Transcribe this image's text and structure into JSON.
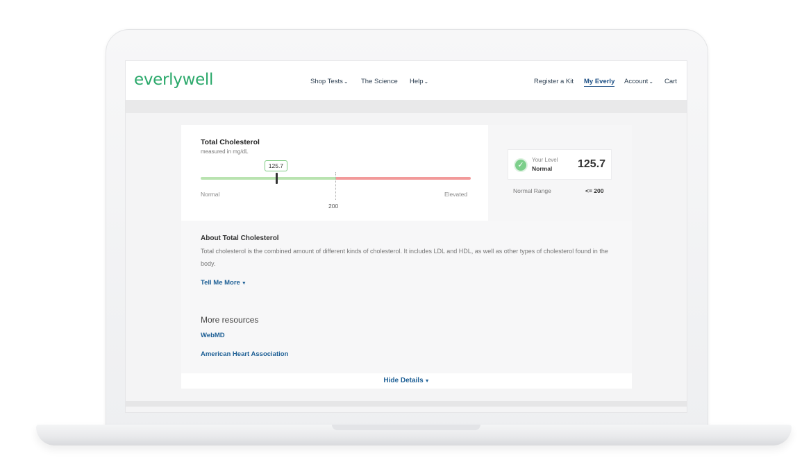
{
  "brand": {
    "logo": "everlywell",
    "color": "#2aa86a"
  },
  "nav": {
    "left": [
      {
        "label": "Shop Tests",
        "dropdown": true
      },
      {
        "label": "The Science",
        "dropdown": false
      },
      {
        "label": "Help",
        "dropdown": true
      }
    ],
    "right": [
      {
        "label": "Register a Kit",
        "dropdown": false
      },
      {
        "label": "My Everly",
        "dropdown": false,
        "active": true
      },
      {
        "label": "Account",
        "dropdown": true
      },
      {
        "label": "Cart",
        "dropdown": false
      }
    ]
  },
  "result": {
    "title": "Total Cholesterol",
    "unit_label": "measured in mg/dL",
    "value": "125.7",
    "range_low_label": "Normal",
    "range_high_label": "Elevated",
    "threshold": "200",
    "marker_fraction": 0.28,
    "level_label": "Your Level",
    "level_status": "Normal",
    "normal_range_label": "Normal Range",
    "normal_range_value": "<= 200",
    "colors": {
      "normal": "#b9e3b0",
      "elevated": "#f29a9a",
      "check": "#7ccf8b"
    }
  },
  "about": {
    "title": "About Total Cholesterol",
    "text": "Total cholesterol is the combined amount of different kinds of cholesterol. It includes LDL and HDL, as well as other types of cholesterol found in the body.",
    "tell_more": "Tell Me More"
  },
  "resources": {
    "title": "More resources",
    "links": [
      "WebMD",
      "American Heart Association"
    ]
  },
  "footer": {
    "hide_details": "Hide Details"
  },
  "link_color": "#1d5f95"
}
